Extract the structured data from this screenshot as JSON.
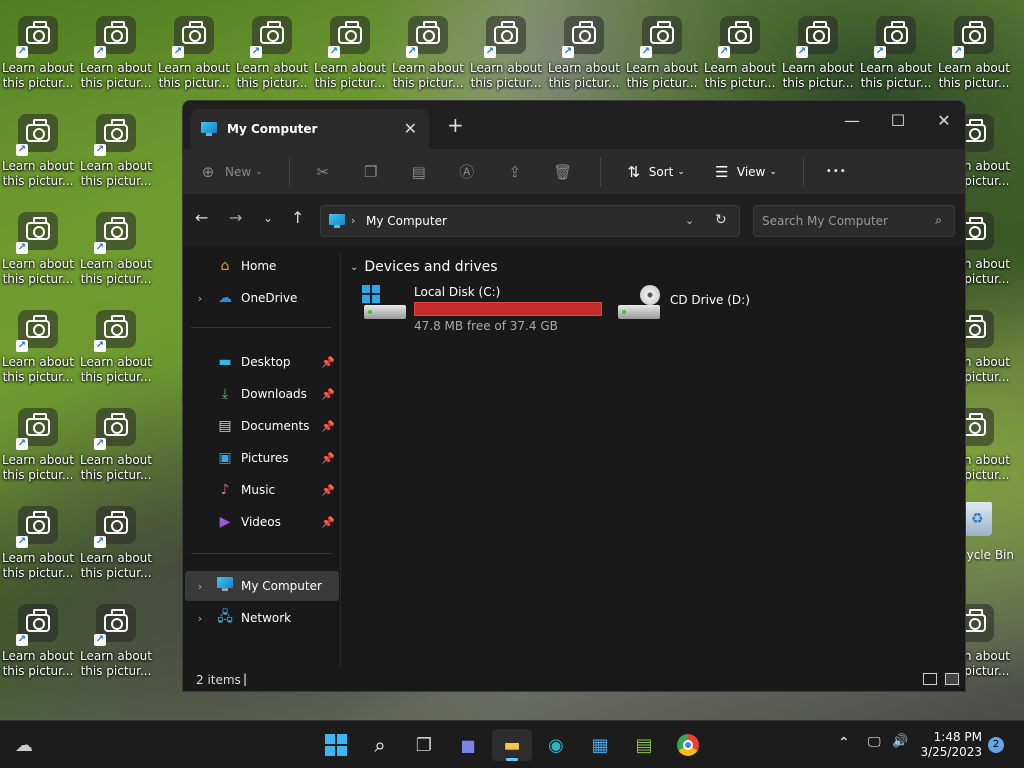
{
  "desktop": {
    "shortcut_label": "Learn about\nthis pictur...",
    "recycle_bin_label": "cycle Bin"
  },
  "window": {
    "tab_title": "My Computer",
    "new_tab": "+",
    "minimize": "—",
    "maximize": "☐",
    "close": "✕"
  },
  "toolbar": {
    "new_label": "New",
    "sort_label": "Sort",
    "view_label": "View",
    "more_label": "•••"
  },
  "address": {
    "path": "My Computer",
    "search_placeholder": "Search My Computer"
  },
  "sidebar": {
    "home": "Home",
    "onedrive": "OneDrive",
    "desktop": "Desktop",
    "downloads": "Downloads",
    "documents": "Documents",
    "pictures": "Pictures",
    "music": "Music",
    "videos": "Videos",
    "my_computer": "My Computer",
    "network": "Network"
  },
  "content": {
    "section_title": "Devices and drives",
    "drives": [
      {
        "name": "Local Disk (C:)",
        "free_text": "47.8 MB free of 37.4 GB",
        "used_fraction": 0.999
      },
      {
        "name": "CD Drive (D:)"
      }
    ]
  },
  "status": {
    "items": "2 items"
  },
  "taskbar": {
    "time": "1:48 PM",
    "date": "3/25/2023",
    "notification_count": "2"
  },
  "colors": {
    "accent": "#60cdff",
    "drive_bar_full": "#c42b2b",
    "window_bg": "#191919"
  }
}
